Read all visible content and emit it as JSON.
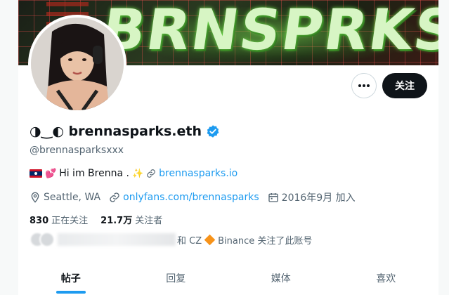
{
  "profile": {
    "display_name": "◑‿◐ brennasparks.eth",
    "handle": "@brennasparksxxx",
    "verified": true
  },
  "actions": {
    "more_label": "…",
    "follow_label": "关注"
  },
  "bio": {
    "text": "Hi im Brenna .",
    "link_label": "brennasparks.io"
  },
  "meta": {
    "location": "Seattle, WA",
    "website": "onlyfans.com/brennasparks",
    "joined": "2016年9月 加入"
  },
  "counts": {
    "following_value": "830",
    "following_label": "正在关注",
    "followers_value": "21.7万",
    "followers_label": "关注者"
  },
  "followed_by": {
    "text_prefix": "和 CZ",
    "text_suffix": "Binance 关注了此账号"
  },
  "tabs": [
    {
      "label": "帖子",
      "active": true
    },
    {
      "label": "回复",
      "active": false
    },
    {
      "label": "媒体",
      "active": false
    },
    {
      "label": "喜欢",
      "active": false
    }
  ],
  "colors": {
    "accent": "#1d9bf0",
    "text_primary": "#0f1419",
    "text_secondary": "#536471",
    "binance": "#f7931a"
  },
  "icons": [
    "more-dots-icon",
    "verified-badge-icon",
    "link-icon",
    "location-icon",
    "calendar-icon",
    "binance-diamond-icon"
  ]
}
